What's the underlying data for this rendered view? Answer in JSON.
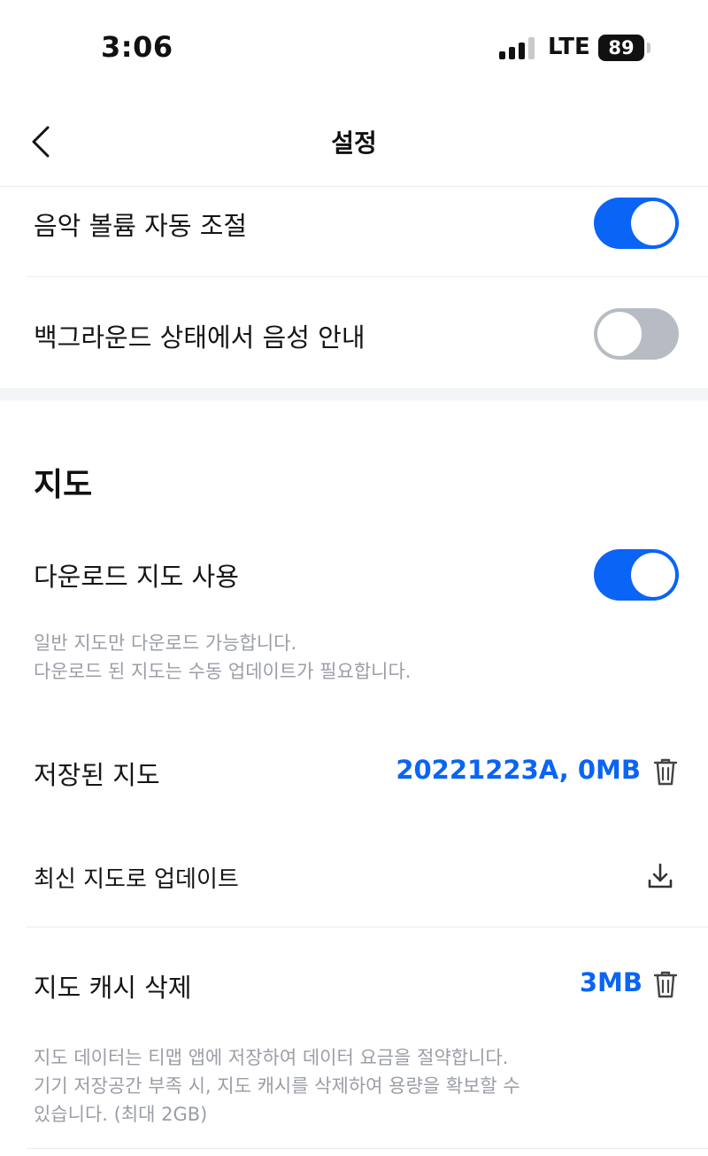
{
  "status_bar": {
    "time": "3:06",
    "network": "LTE",
    "battery": "89"
  },
  "nav": {
    "title": "설정"
  },
  "settings": {
    "auto_volume_label": "음악 볼륨 자동 조절",
    "auto_volume_on": true,
    "background_voice_label": "백그라운드 상태에서 음성 안내",
    "background_voice_on": false
  },
  "map_section": {
    "title": "지도",
    "download_map_label": "다운로드 지도 사용",
    "download_map_on": true,
    "download_desc_line1": "일반 지도만 다운로드 가능합니다.",
    "download_desc_line2": "다운로드 된 지도는 수동 업데이트가 필요합니다.",
    "saved_map_label": "저장된 지도",
    "saved_map_value": "20221223A, 0MB",
    "update_label": "최신 지도로 업데이트",
    "cache_label": "지도 캐시 삭제",
    "cache_value": "3MB",
    "cache_desc_line1": "지도 데이터는 티맵 앱에 저장하여 데이터 요금을 절약합니다.",
    "cache_desc_line2": "기기 저장공간 부족 시, 지도 캐시를 삭제하여 용량을 확보할 수",
    "cache_desc_line3": "있습니다. (최대 2GB)"
  },
  "colors": {
    "accent": "#0a64f5",
    "toggle_off": "#b7bcc4",
    "desc_text": "#9a9ea6"
  },
  "icons": {
    "back": "chevron-left-icon",
    "trash": "trash-icon",
    "download": "download-icon"
  }
}
